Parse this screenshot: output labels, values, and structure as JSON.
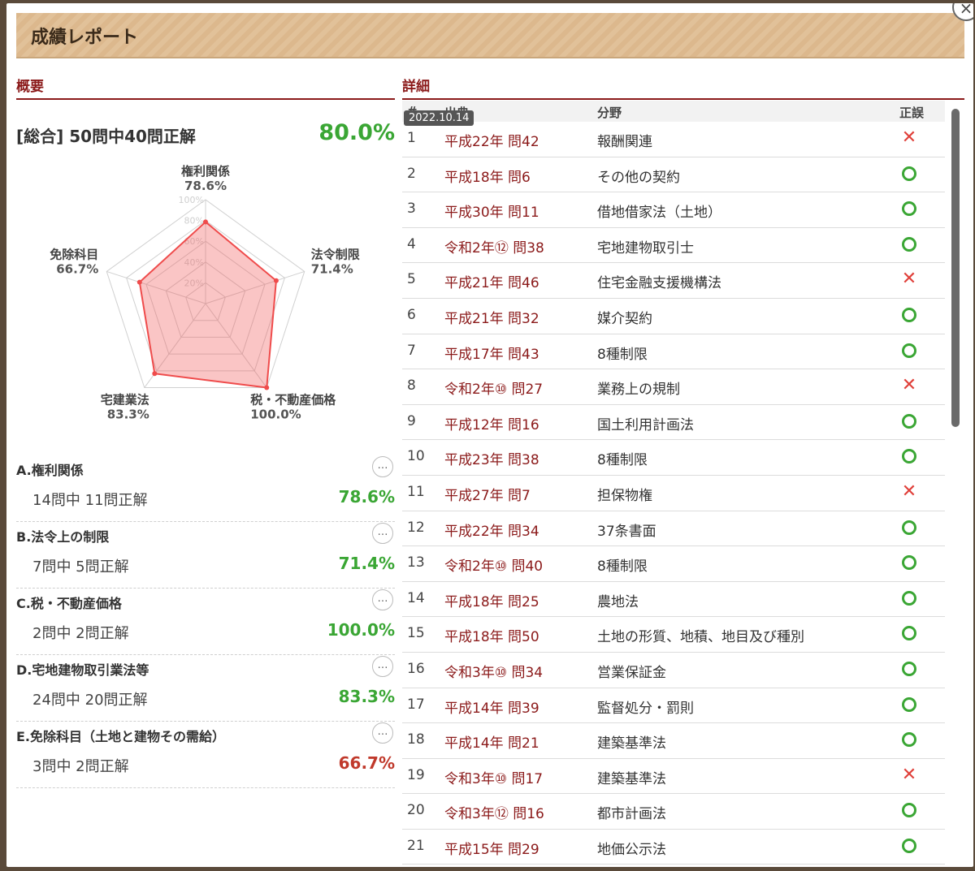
{
  "header": {
    "title": "成績レポート",
    "close": "×"
  },
  "overview": {
    "heading": "概要",
    "total_label": "[総合] 50問中40問正解",
    "total_pct": "80.0%",
    "radar": {
      "ring_labels": [
        "20%",
        "40%",
        "60%",
        "80%",
        "100%"
      ],
      "axes": [
        {
          "label": "権利関係",
          "value_text": "78.6%",
          "value": 78.6
        },
        {
          "label": "法令制限",
          "value_text": "71.4%",
          "value": 71.4
        },
        {
          "label": "税・不動産価格",
          "value_text": "100.0%",
          "value": 100.0
        },
        {
          "label": "宅建業法",
          "value_text": "83.3%",
          "value": 83.3
        },
        {
          "label": "免除科目",
          "value_text": "66.7%",
          "value": 66.7
        }
      ]
    },
    "categories": [
      {
        "name": "A.権利関係",
        "count": "14問中 11問正解",
        "pct": "78.6%",
        "color": "#3aa634",
        "more": "…"
      },
      {
        "name": "B.法令上の制限",
        "count": "7問中 5問正解",
        "pct": "71.4%",
        "color": "#3aa634",
        "more": "…"
      },
      {
        "name": "C.税・不動産価格",
        "count": "2問中 2問正解",
        "pct": "100.0%",
        "color": "#3aa634",
        "more": "…"
      },
      {
        "name": "D.宅地建物取引業法等",
        "count": "24問中 20問正解",
        "pct": "83.3%",
        "color": "#3aa634",
        "more": "…"
      },
      {
        "name": "E.免除科目（土地と建物その需給）",
        "count": "3問中 2問正解",
        "pct": "66.7%",
        "color": "#c0392b",
        "more": "…"
      }
    ]
  },
  "detail": {
    "heading": "詳細",
    "columns": {
      "no": "#",
      "source": "出典",
      "field": "分野",
      "result": "正誤"
    },
    "tooltip": "2022.10.14",
    "rows": [
      {
        "no": "1",
        "source": "平成22年 問42",
        "field": "報酬関連",
        "ok": false
      },
      {
        "no": "2",
        "source": "平成18年 問6",
        "field": "その他の契約",
        "ok": true
      },
      {
        "no": "3",
        "source": "平成30年 問11",
        "field": "借地借家法（土地）",
        "ok": true
      },
      {
        "no": "4",
        "source": "令和2年⑫ 問38",
        "field": "宅地建物取引士",
        "ok": true
      },
      {
        "no": "5",
        "source": "平成21年 問46",
        "field": "住宅金融支援機構法",
        "ok": false
      },
      {
        "no": "6",
        "source": "平成21年 問32",
        "field": "媒介契約",
        "ok": true
      },
      {
        "no": "7",
        "source": "平成17年 問43",
        "field": "8種制限",
        "ok": true
      },
      {
        "no": "8",
        "source": "令和2年⑩ 問27",
        "field": "業務上の規制",
        "ok": false
      },
      {
        "no": "9",
        "source": "平成12年 問16",
        "field": "国土利用計画法",
        "ok": true
      },
      {
        "no": "10",
        "source": "平成23年 問38",
        "field": "8種制限",
        "ok": true
      },
      {
        "no": "11",
        "source": "平成27年 問7",
        "field": "担保物権",
        "ok": false
      },
      {
        "no": "12",
        "source": "平成22年 問34",
        "field": "37条書面",
        "ok": true
      },
      {
        "no": "13",
        "source": "令和2年⑩ 問40",
        "field": "8種制限",
        "ok": true
      },
      {
        "no": "14",
        "source": "平成18年 問25",
        "field": "農地法",
        "ok": true
      },
      {
        "no": "15",
        "source": "平成18年 問50",
        "field": "土地の形質、地積、地目及び種別",
        "ok": true
      },
      {
        "no": "16",
        "source": "令和3年⑩ 問34",
        "field": "営業保証金",
        "ok": true
      },
      {
        "no": "17",
        "source": "平成14年 問39",
        "field": "監督処分・罰則",
        "ok": true
      },
      {
        "no": "18",
        "source": "平成14年 問21",
        "field": "建築基準法",
        "ok": true
      },
      {
        "no": "19",
        "source": "令和3年⑩ 問17",
        "field": "建築基準法",
        "ok": false
      },
      {
        "no": "20",
        "source": "令和3年⑫ 問16",
        "field": "都市計画法",
        "ok": true
      },
      {
        "no": "21",
        "source": "平成15年 問29",
        "field": "地価公示法",
        "ok": true
      }
    ]
  }
}
